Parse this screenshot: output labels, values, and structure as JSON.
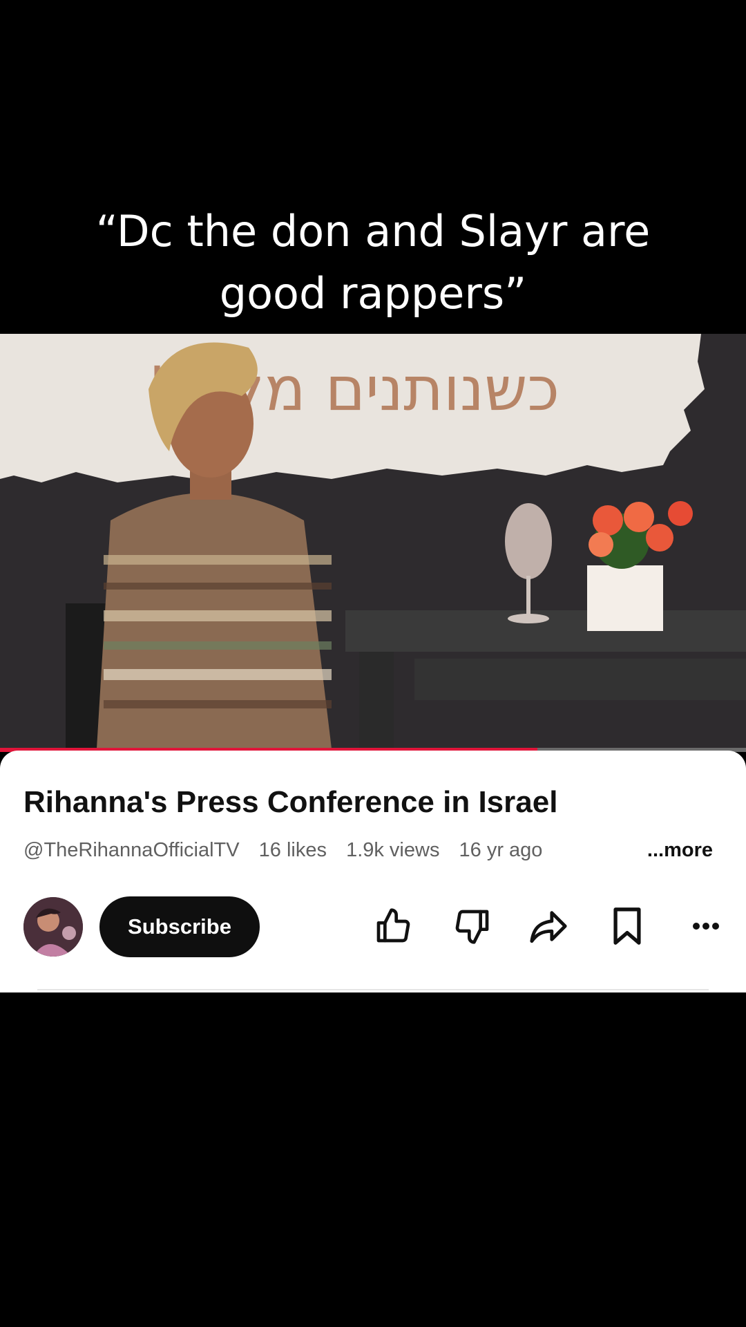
{
  "caption": {
    "line1": "“Dc the don and Slayr are",
    "line2": "good rappers”"
  },
  "video": {
    "progress": 0.72
  },
  "info": {
    "title": "Rihanna's Press Conference in Israel",
    "channel": "@TheRihannaOfficialTV",
    "likes": "16 likes",
    "views": "1.9k views",
    "age": "16 yr ago",
    "more": "...more"
  },
  "actions": {
    "subscribe_label": "Subscribe",
    "icons": [
      "thumbs-up-icon",
      "thumbs-down-icon",
      "share-icon",
      "save-icon",
      "more-options-icon"
    ]
  },
  "colors": {
    "accent_red": "#e0153a",
    "subscribe_bg": "#0f0f0f",
    "meta_gray": "#606060"
  }
}
